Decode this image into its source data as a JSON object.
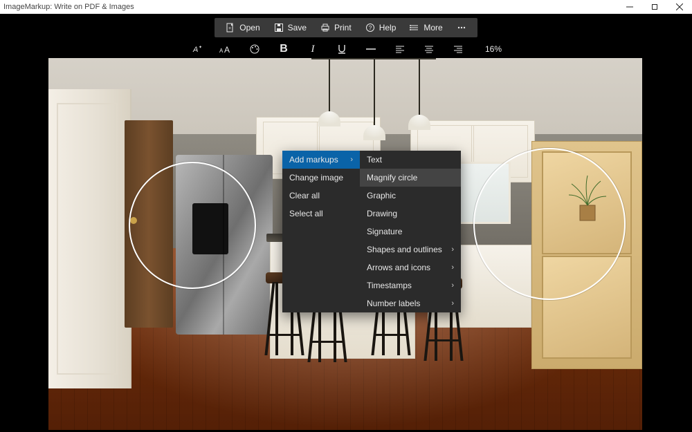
{
  "window": {
    "title": "ImageMarkup: Write on PDF & Images"
  },
  "toolbar": {
    "open": "Open",
    "save": "Save",
    "print": "Print",
    "help": "Help",
    "more": "More"
  },
  "format": {
    "zoom": "16%"
  },
  "context_menu": {
    "primary": [
      {
        "label": "Add markups",
        "has_submenu": true,
        "selected": true
      },
      {
        "label": "Change image",
        "has_submenu": false
      },
      {
        "label": "Clear all",
        "has_submenu": false
      },
      {
        "label": "Select all",
        "has_submenu": false
      }
    ],
    "submenu": [
      {
        "label": "Text",
        "has_submenu": false
      },
      {
        "label": "Magnify circle",
        "has_submenu": false,
        "hover": true
      },
      {
        "label": "Graphic",
        "has_submenu": false
      },
      {
        "label": "Drawing",
        "has_submenu": false
      },
      {
        "label": "Signature",
        "has_submenu": false
      },
      {
        "label": "Shapes and outlines",
        "has_submenu": true
      },
      {
        "label": "Arrows and icons",
        "has_submenu": true
      },
      {
        "label": "Timestamps",
        "has_submenu": true
      },
      {
        "label": "Number labels",
        "has_submenu": true
      }
    ]
  }
}
